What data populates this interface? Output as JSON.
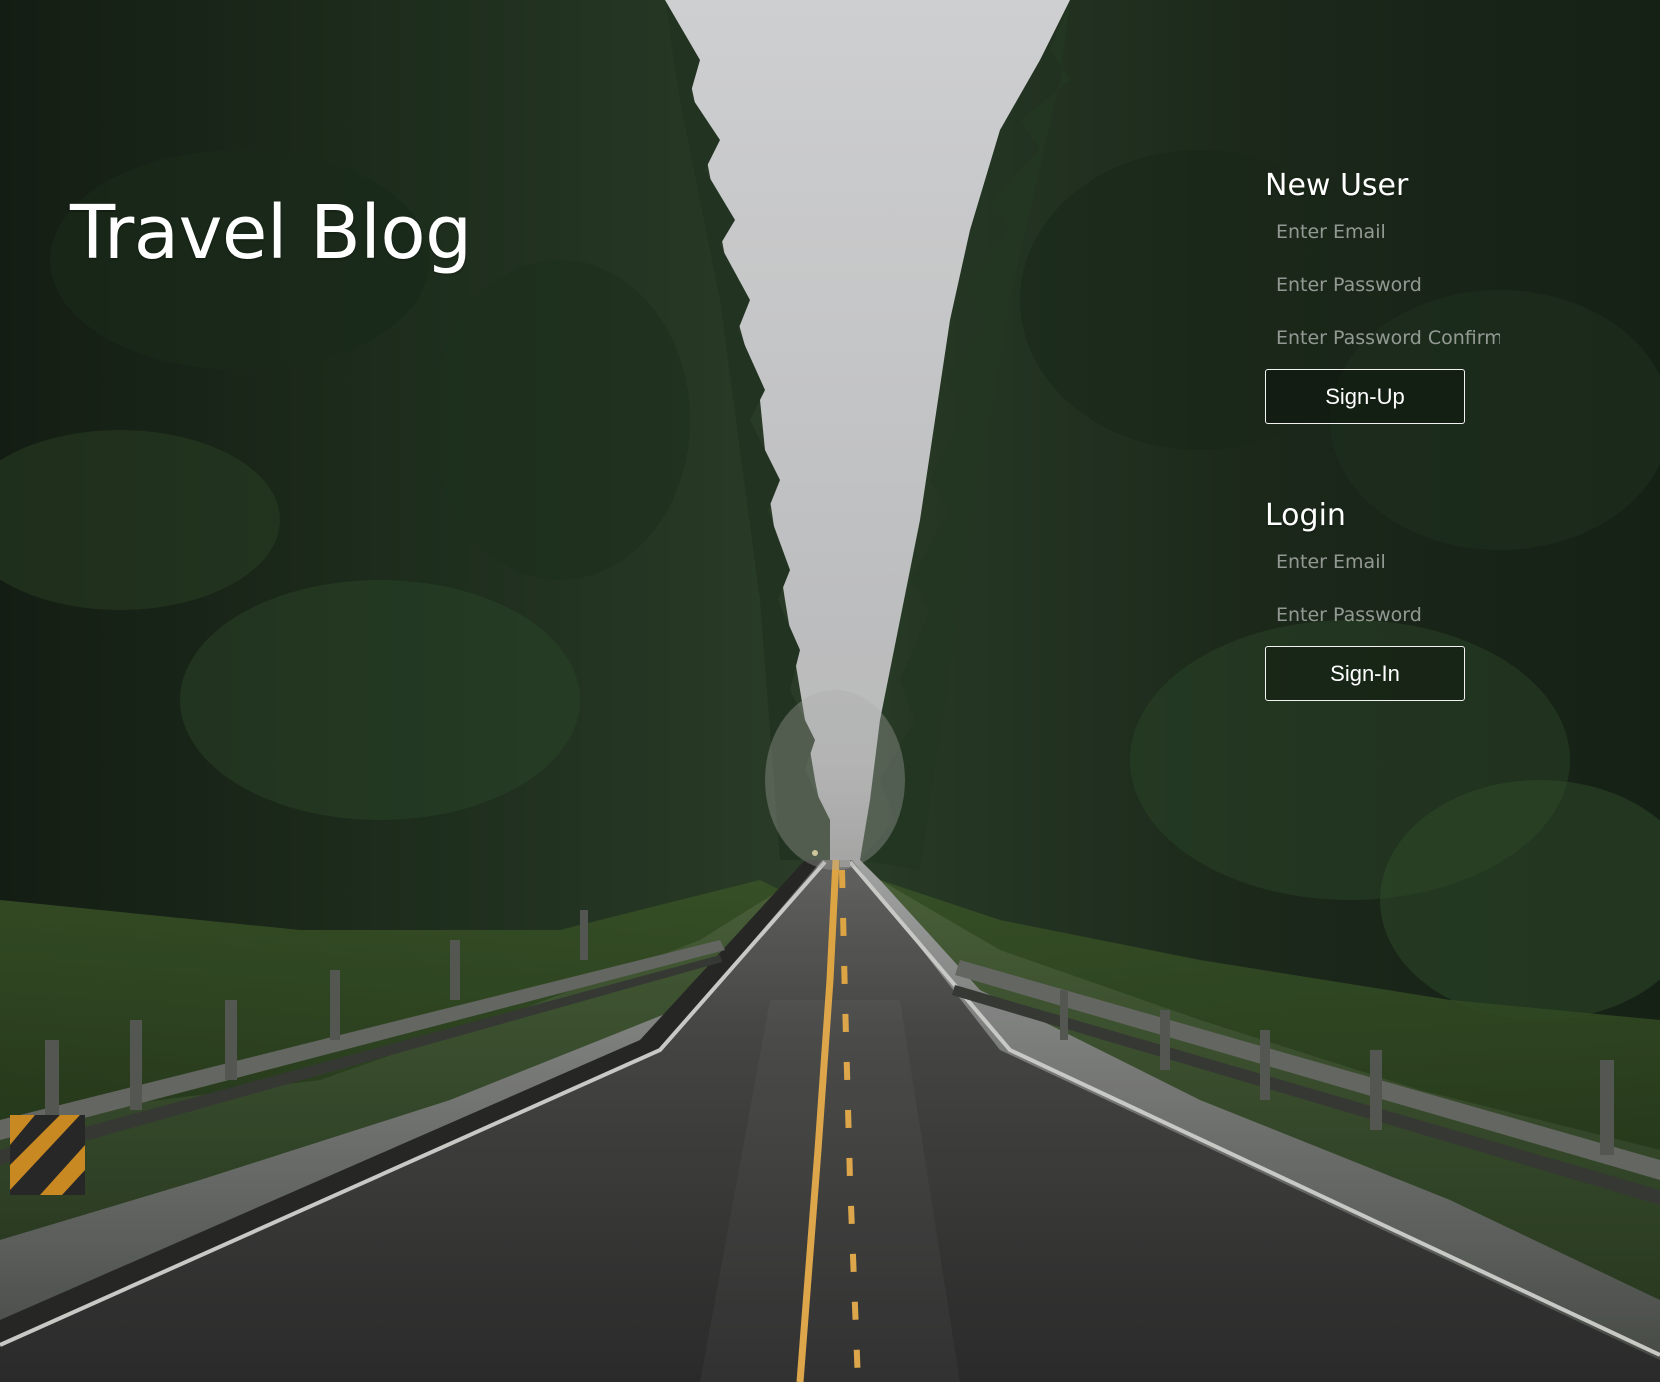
{
  "page": {
    "title": "Travel Blog"
  },
  "background": {
    "description_icon": "forest-road-photo",
    "sky_color": "#d7d8da",
    "forest_color": "#1f2d1f",
    "road_color": "#363636",
    "line_color": "#f0b24a"
  },
  "signup": {
    "heading": "New User",
    "email_placeholder": "Enter Email",
    "password_placeholder": "Enter Password",
    "confirm_placeholder": "Enter Password Confirmation",
    "button_label": "Sign-Up"
  },
  "login": {
    "heading": "Login",
    "email_placeholder": "Enter Email",
    "password_placeholder": "Enter Password",
    "button_label": "Sign-In"
  }
}
